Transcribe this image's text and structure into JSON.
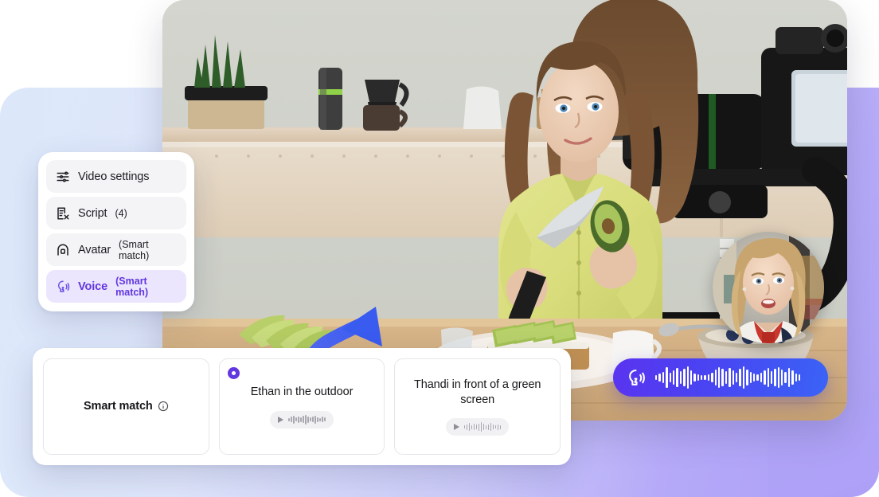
{
  "menu": {
    "name": "video-config-menu",
    "items": [
      {
        "icon": "sliders-icon",
        "label": "Video settings",
        "sub": "",
        "active": false
      },
      {
        "icon": "script-icon",
        "label": "Script",
        "sub": "(4)",
        "active": false
      },
      {
        "icon": "avatar-icon",
        "label": "Avatar",
        "sub": "(Smart match)",
        "active": false
      },
      {
        "icon": "voice-icon",
        "label": "Voice",
        "sub": "(Smart match)",
        "active": true
      }
    ]
  },
  "voice_options": {
    "title": "voice-options-card",
    "items": [
      {
        "title": "Smart match",
        "selected": false,
        "has_info": true,
        "has_player": false
      },
      {
        "title": "Ethan in the outdoor",
        "selected": true,
        "has_info": false,
        "has_player": true
      },
      {
        "title": "Thandi in front of a green screen",
        "selected": false,
        "has_info": false,
        "has_player": true
      }
    ]
  },
  "waveform_pill": {
    "icon": "voice-speaking-icon",
    "bars": [
      6,
      10,
      14,
      26,
      12,
      18,
      24,
      16,
      22,
      28,
      18,
      10,
      8,
      6,
      6,
      8,
      12,
      20,
      26,
      22,
      16,
      24,
      18,
      12,
      22,
      28,
      20,
      14,
      10,
      8,
      12,
      18,
      24,
      16,
      22,
      26,
      20,
      14,
      24,
      18,
      10,
      8
    ]
  },
  "player": {
    "play_icon": "play-icon",
    "bars": [
      4,
      7,
      10,
      5,
      8,
      6,
      9,
      12,
      8,
      5,
      7,
      10,
      6,
      4,
      7,
      5
    ]
  },
  "colors": {
    "accent_purple": "#6236e0",
    "accent_blue": "#3a5bf0",
    "menu_active_bg": "#ebe6fd",
    "menu_item_bg": "#f4f4f6",
    "pill_gradient_start": "#5a34ef",
    "pill_gradient_end": "#3a63f6",
    "bg_left": "#dce8fa",
    "bg_right": "#ada0f7"
  },
  "video": {
    "name": "kitchen-cooking-scene",
    "description": "Woman in a yellow-green shirt slicing an avocado in a kitchen, DSLR camera on gimbal at right, avocado toast on table",
    "avatar_bubble": "presenter-avatar-bubble",
    "arrow": "blue-curved-arrow"
  }
}
